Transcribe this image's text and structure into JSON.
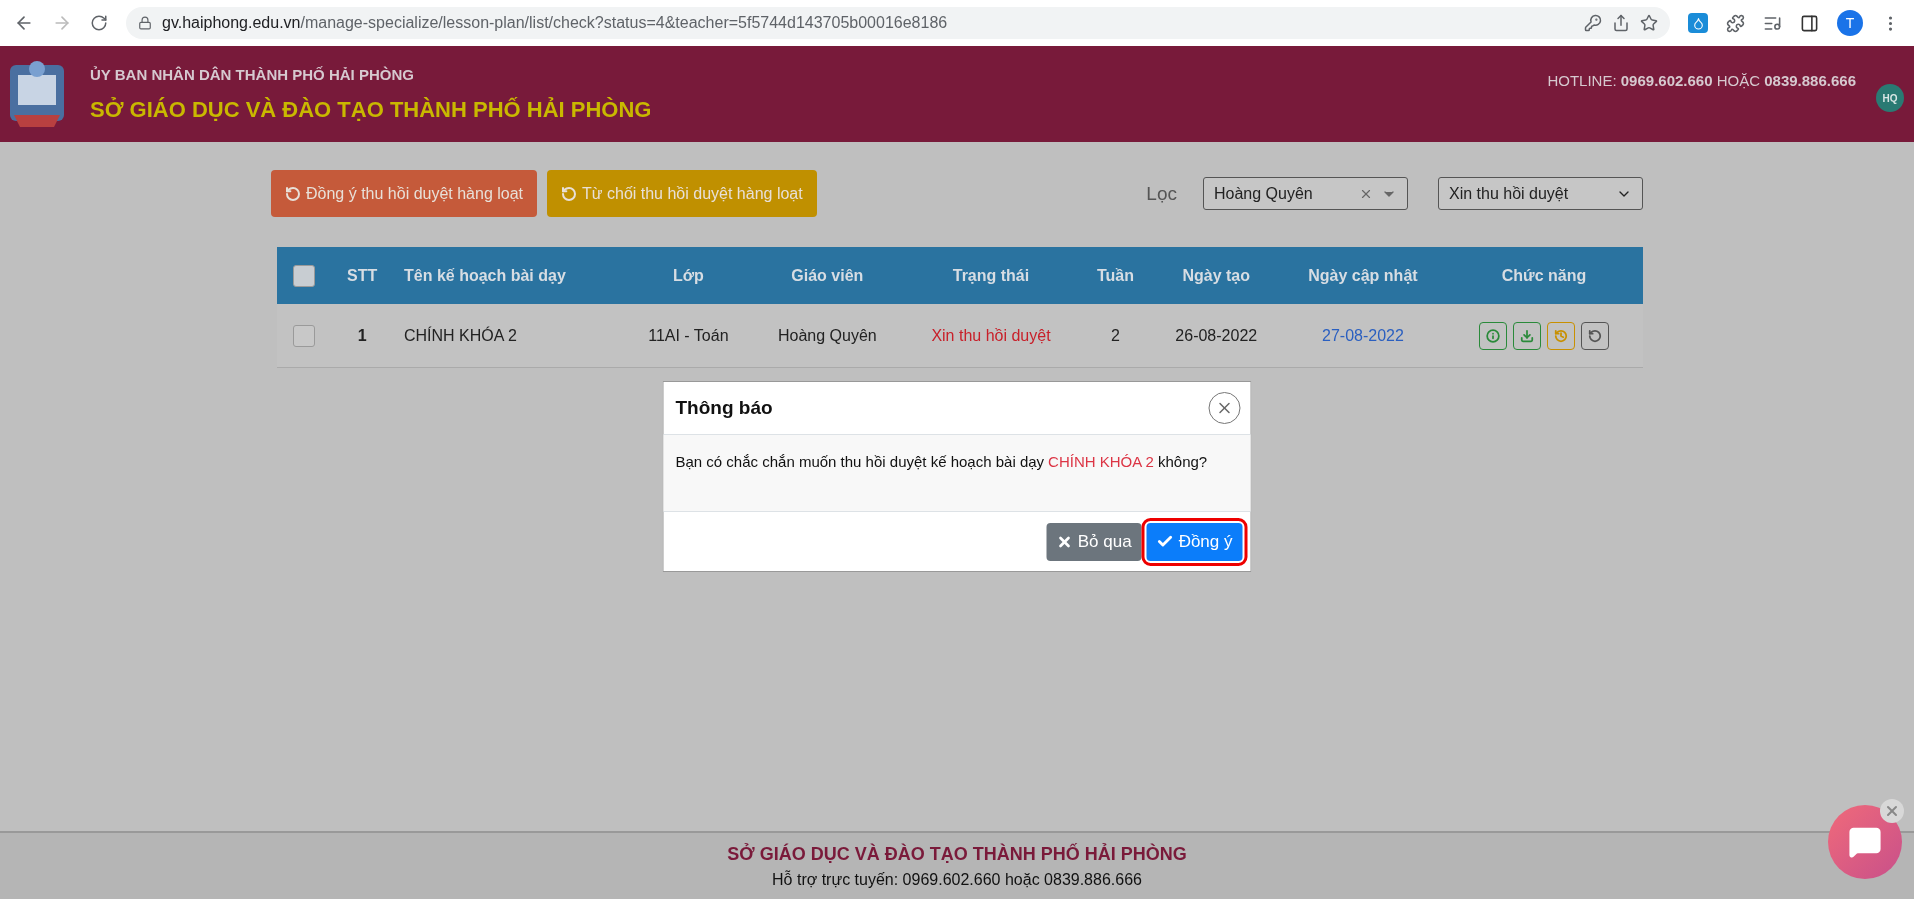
{
  "browser": {
    "url_host": "gv.haiphong.edu.vn",
    "url_path": "/manage-specialize/lesson-plan/list/check?status=4&teacher=5f5744d143705b00016e8186",
    "profile": "T"
  },
  "header": {
    "subtitle": "ỦY BAN NHÂN DÂN THÀNH PHỐ HẢI PHÒNG",
    "title": "SỞ GIÁO DỤC VÀ ĐÀO TẠO THÀNH PHỐ HẢI PHÒNG",
    "hotline": "HOTLINE: **0969.602.660** HOẶC **0839.886.666**",
    "avatar": "HQ"
  },
  "toolbar": {
    "buttons": [
      {
        "label": "Đồng ý thu hồi duyệt hàng loạt",
        "kind": "approve"
      },
      {
        "label": "Từ chối thu hồi duyệt hàng loạt",
        "kind": "reject"
      }
    ],
    "filter_label": "Lọc",
    "teacher_filter": {
      "value": "Hoàng Quyên"
    },
    "status_filter": {
      "value": "Xin thu hồi duyệt"
    }
  },
  "table": {
    "select_all": {
      "checked": false
    },
    "columns": [
      "STT",
      "Tên kế hoạch bài dạy",
      "Lớp",
      "Giáo viên",
      "Trạng thái",
      "Tuần",
      "Ngày tạo",
      "Ngày cập nhật",
      "Chức năng"
    ],
    "rows": [
      {
        "checked": false,
        "stt": "1",
        "name": "CHÍNH KHÓA 2",
        "class": "11AI - Toán",
        "teacher": "Hoàng Quyên",
        "status": "Xin thu hồi duyệt",
        "week": "2",
        "created": "26-08-2022",
        "updated": "27-08-2022",
        "actions": [
          {
            "kind": "info"
          },
          {
            "kind": "download"
          },
          {
            "kind": "history"
          },
          {
            "kind": "undo"
          }
        ]
      }
    ]
  },
  "dialog": {
    "title": "Thông báo",
    "message_before": "Bạn có chắc chắn muốn thu hồi duyệt kế hoạch bài dạy",
    "message_highlight": "CHÍNH KHÓA 2",
    "message_after": "không?",
    "buttons": [
      {
        "label": "Bỏ qua",
        "kind": "cancel",
        "highlighted": false
      },
      {
        "label": "Đồng ý",
        "kind": "confirm",
        "highlighted": true
      }
    ]
  },
  "footer": {
    "title": "SỞ GIÁO DỤC VÀ ĐÀO TẠO THÀNH PHỐ HẢI PHÒNG",
    "support": "Hỗ trợ trực tuyến: 0969.602.660 hoặc 0839.886.666"
  }
}
